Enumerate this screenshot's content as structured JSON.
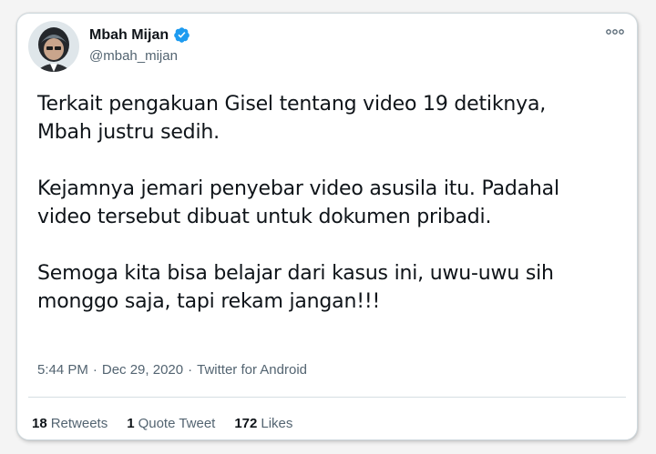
{
  "tweet": {
    "author": {
      "display_name": "Mbah Mijan",
      "handle": "@mbah_mijan",
      "verified": true,
      "avatar_icon": "avatar-photo"
    },
    "paragraphs": [
      [
        "Terkait pengakuan Gisel tentang video 19 detiknya,",
        "Mbah justru sedih."
      ],
      [
        "Kejamnya jemari penyebar video asusila itu. Padahal",
        "video tersebut dibuat untuk dokumen pribadi."
      ],
      [
        "Semoga kita bisa belajar dari kasus ini, uwu-uwu sih",
        "monggo saja, tapi rekam jangan!!!"
      ]
    ],
    "meta": {
      "time": "5:44 PM",
      "separator": "·",
      "date": "Dec 29, 2020",
      "source": "Twitter for Android"
    },
    "stats": {
      "retweets_count": "18",
      "retweets_label": "Retweets",
      "quotes_count": "1",
      "quotes_label": "Quote Tweet",
      "likes_count": "172",
      "likes_label": "Likes"
    },
    "colors": {
      "verified": "#1d9bf0",
      "secondary_text": "#536471",
      "primary_text": "#0f1419"
    }
  }
}
